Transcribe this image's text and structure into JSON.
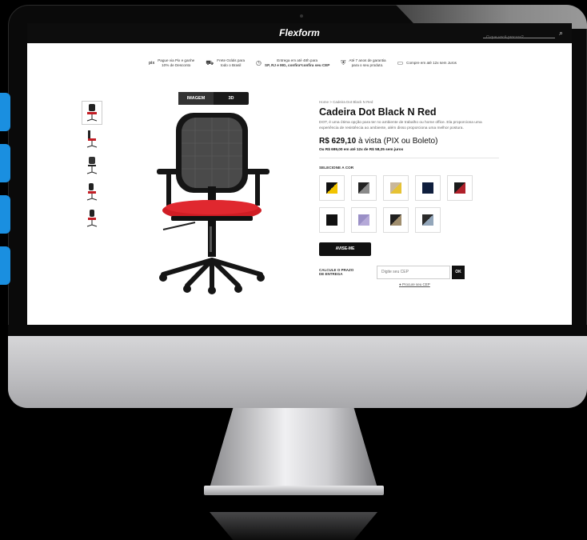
{
  "site": {
    "logo": "Flexform",
    "search_placeholder": "O que você procura?"
  },
  "benefits": [
    {
      "icon": "pix-icon",
      "glyph": "pix",
      "line1": "Pague via Pix e ganhe",
      "line2": "10% de Desconto"
    },
    {
      "icon": "truck-icon",
      "glyph": "⛟",
      "line1": "Frete Grátis para",
      "line2": "todo o Brasil"
    },
    {
      "icon": "clock-icon",
      "glyph": "◷",
      "line1": "Entrega em até 48h para",
      "line2": "SP, RJ e MG, confira*confira seu CEP"
    },
    {
      "icon": "shield-icon",
      "glyph": "⛨",
      "line1": "Até 7 anos de garantia",
      "line2": "para o seu produto."
    },
    {
      "icon": "card-icon",
      "glyph": "▭",
      "line1": "Compre em até 12x sem Juros",
      "line2": ""
    }
  ],
  "view_toggle": {
    "image_label": "IMAGEM",
    "three_d_label": "3D"
  },
  "product": {
    "breadcrumb": "Home > Cadeira Dot Black N Red",
    "title": "Cadeira Dot Black N Red",
    "description": "DOT, é uma ótima opção para ter no ambiente de trabalho ou home office. Ela proporciona uma experiência de resistência ao ambiente, além disso proporciona uma melhor postura.",
    "price": "R$ 629,10",
    "price_suffix": "à vista (PIX ou Boleto)",
    "installments": "Ou R$ 699,00 em até 12x de R$ 58,25 sem juros",
    "color_label": "SELECIONE A COR",
    "notify_label": "AVISE-ME",
    "shipping_label_1": "CALCULE O PRAZO",
    "shipping_label_2": "DE ENTREGA",
    "cep_placeholder": "Digite seu CEP",
    "ok_label": "OK",
    "cep_link": "Procure seu CEP"
  },
  "colors": {
    "swatches": [
      [
        "#111111",
        "#f2c400"
      ],
      [
        "#222222",
        "#8a8a8a"
      ],
      [
        "#c9b79a",
        "#e6c233"
      ],
      [
        "#0f1e3d",
        "#0f1e3d"
      ],
      [
        "#1b1b1b",
        "#b0202a"
      ],
      [
        "#111111",
        "#111111"
      ],
      [
        "#9a8fc6",
        "#b5a9d8"
      ],
      [
        "#1f1f1f",
        "#a08e6e"
      ],
      [
        "#2a2a2a",
        "#93a6ba"
      ]
    ],
    "accent_side_buttons": "#1a8fe0",
    "seat_red": "#d01d24"
  }
}
